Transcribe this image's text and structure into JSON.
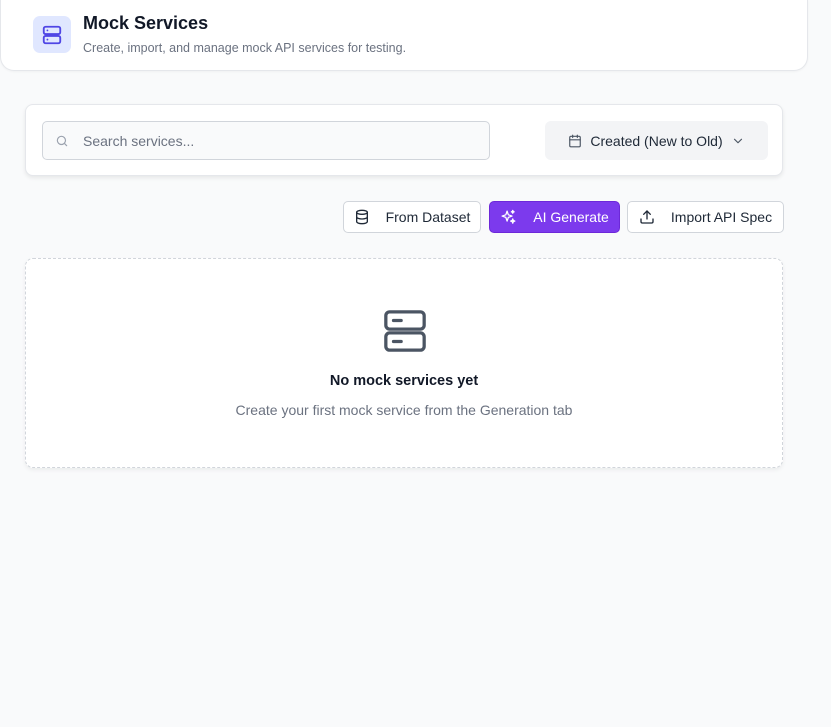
{
  "header": {
    "title": "Mock Services",
    "subtitle": "Create, import, and manage mock API services for testing.",
    "icon": "server-icon",
    "icon_color": "#4f46e5"
  },
  "search": {
    "placeholder": "Search services...",
    "value": ""
  },
  "sort": {
    "label": "Created (New to Old)"
  },
  "actions": {
    "from_dataset": "From Dataset",
    "ai_generate": "AI Generate",
    "import_api_spec": "Import API Spec"
  },
  "empty_state": {
    "title": "No mock services yet",
    "message": "Create your first mock service from the Generation tab"
  },
  "colors": {
    "accent": "#7c3aed",
    "background": "#f9fafb"
  }
}
